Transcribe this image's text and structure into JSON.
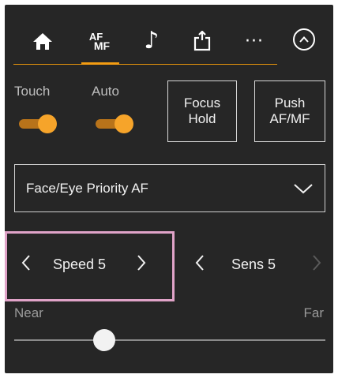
{
  "tabs": [
    {
      "name": "home",
      "icon": "home-icon"
    },
    {
      "name": "af-mf",
      "label_top": "AF",
      "label_bottom": "MF",
      "active": true
    },
    {
      "name": "audio",
      "icon": "music-note-icon",
      "glyph": "♪"
    },
    {
      "name": "export",
      "icon": "export-icon"
    },
    {
      "name": "more",
      "icon": "more-icon",
      "glyph": "···"
    }
  ],
  "collapse_icon": "chevron-up-circle-icon",
  "toggles": [
    {
      "label": "Touch",
      "state": "on"
    },
    {
      "label": "Auto",
      "state": "on"
    }
  ],
  "buttons": {
    "focus_hold_line1": "Focus",
    "focus_hold_line2": "Hold",
    "push_af_mf_line1": "Push",
    "push_af_mf_line2": "AF/MF"
  },
  "dropdown": {
    "selected": "Face/Eye Priority AF"
  },
  "speed": {
    "text": "Speed 5"
  },
  "sens": {
    "text": "Sens 5"
  },
  "slider": {
    "near_label": "Near",
    "far_label": "Far",
    "position": 0.29
  },
  "colors": {
    "accent": "#f39c12",
    "highlight": "#e0a3c8",
    "panel": "#262626"
  }
}
